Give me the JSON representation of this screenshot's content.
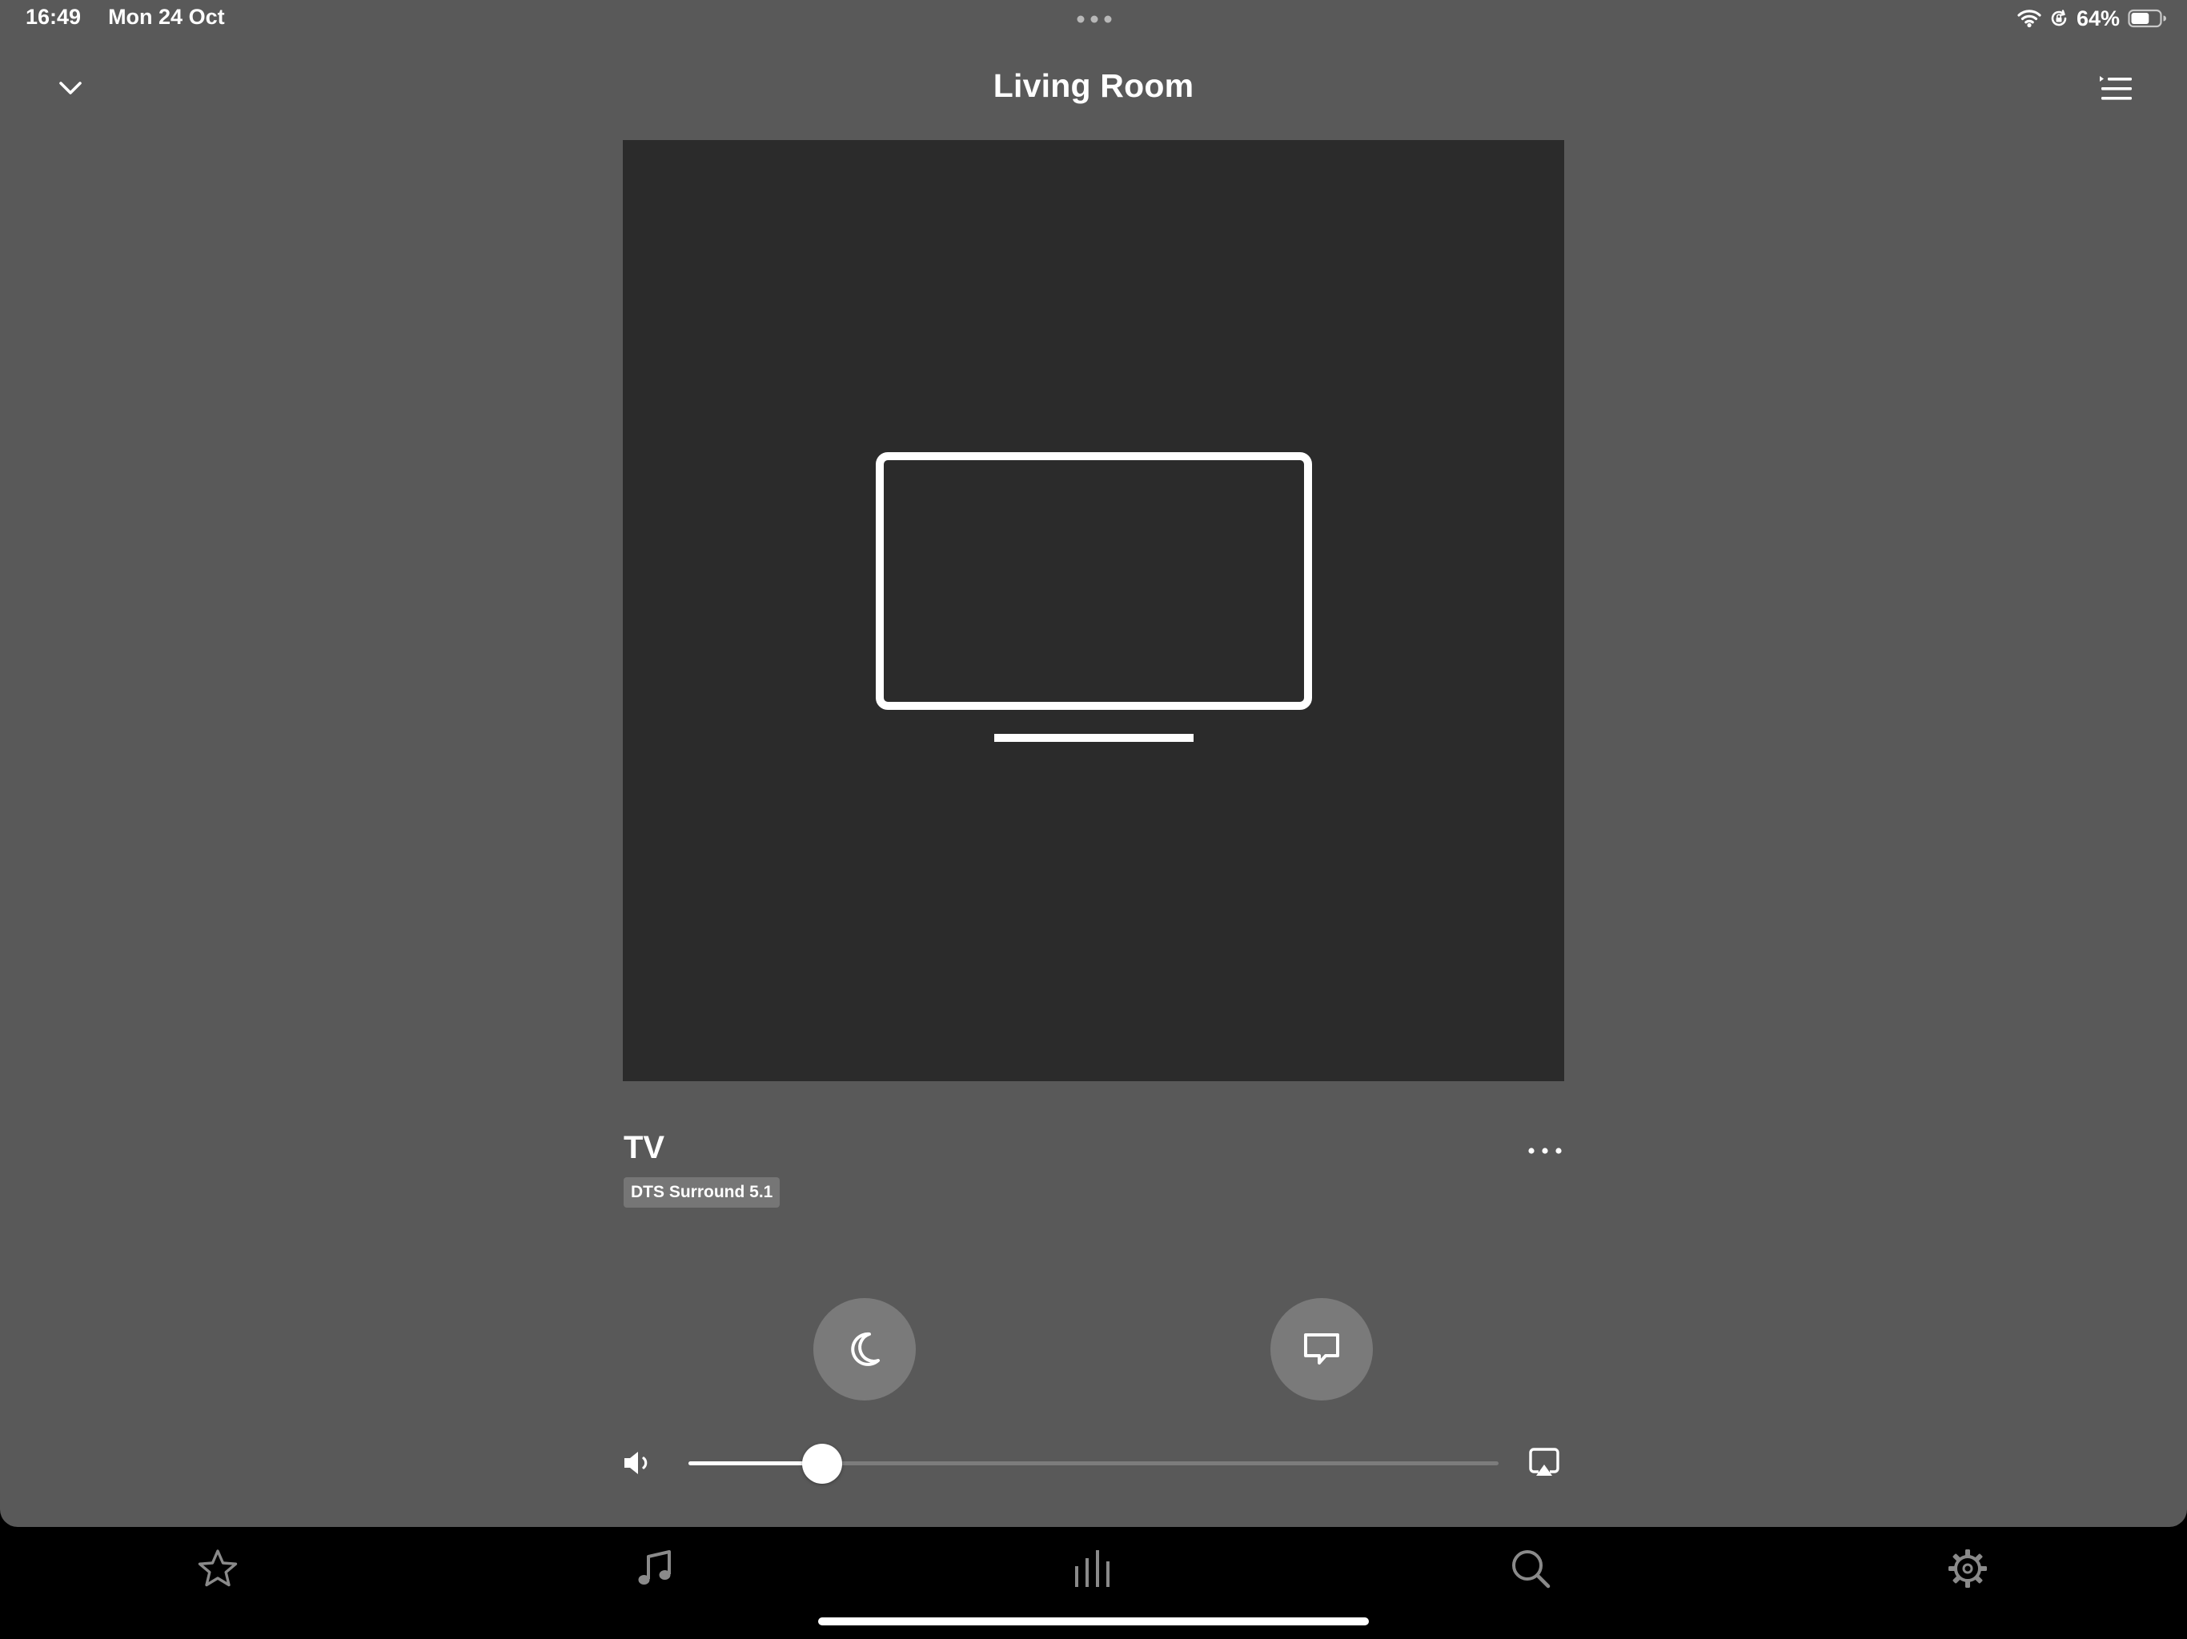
{
  "status_bar": {
    "time": "16:49",
    "date": "Mon 24 Oct",
    "battery_percent": "64%",
    "battery_level": 0.64,
    "icons": [
      "wifi-icon",
      "orientation-lock-icon",
      "battery-icon"
    ]
  },
  "header": {
    "title": "Living Room",
    "left_icon": "chevron-down-icon",
    "right_icon": "queue-list-icon"
  },
  "artwork": {
    "icon": "tv-icon"
  },
  "now_playing": {
    "source": "TV",
    "audio_format": "DTS Surround 5.1",
    "more_icon": "more-icon"
  },
  "controls": {
    "night_sound_icon": "moon-icon",
    "speech_enhancement_icon": "speech-bubble-icon"
  },
  "volume": {
    "level": 0.165,
    "left_icon": "speaker-low-icon",
    "right_icon": "airplay-icon"
  },
  "tab_bar": {
    "tabs": [
      "star-icon",
      "music-note-icon",
      "equalizer-bars-icon",
      "search-icon",
      "gear-icon"
    ],
    "active_tab": 2
  },
  "colors": {
    "sheet_background": "#595959",
    "artwork_background": "#2b2b2b",
    "tab_bar_background": "#000000",
    "button_background": "#7a7a7a",
    "inactive_tab_icon": "#8a8a8a"
  }
}
